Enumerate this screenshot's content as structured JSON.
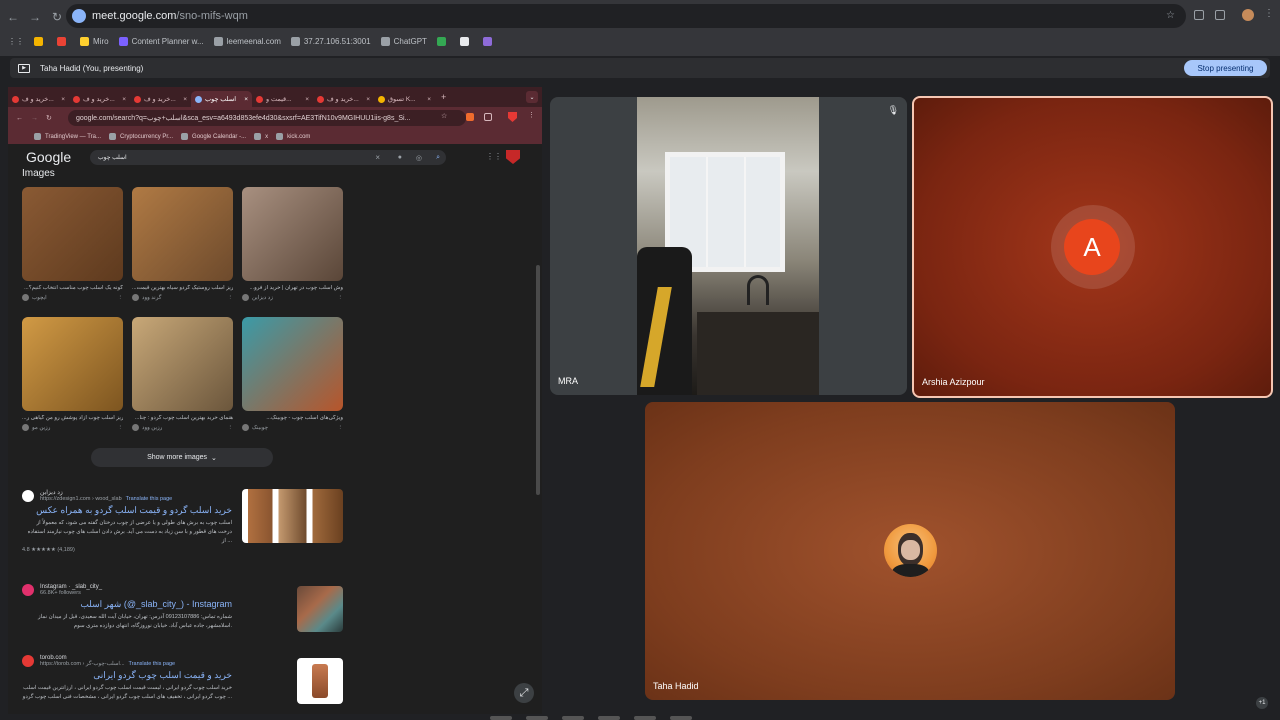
{
  "browser": {
    "url_host": "meet.google.com",
    "url_path": "/sno-mifs-wqm",
    "bookmarks": [
      {
        "label": "",
        "color": "#f4b400"
      },
      {
        "label": "",
        "color": "#ea4335"
      },
      {
        "label": "Miro",
        "color": "#ffd02f"
      },
      {
        "label": "Content Planner w...",
        "color": "#7b61ff"
      },
      {
        "label": "leemeenal.com",
        "color": "#9aa0a6"
      },
      {
        "label": "37.27.106.51:3001",
        "color": "#9aa0a6"
      },
      {
        "label": "ChatGPT",
        "color": "#9aa0a6"
      },
      {
        "label": "",
        "color": "#34a853"
      },
      {
        "label": "",
        "color": "#e8eaed"
      },
      {
        "label": "",
        "color": "#8e6bd8"
      }
    ]
  },
  "presenting": {
    "label": "Taha Hadid (You, presenting)",
    "stop_button": "Stop presenting"
  },
  "shared_screen": {
    "tabs": [
      {
        "label": "خرید و ف..."
      },
      {
        "label": "خرید و ف..."
      },
      {
        "label": "خرید و ف..."
      },
      {
        "label": "اسلب چوب",
        "active": true
      },
      {
        "label": "قیمت و..."
      },
      {
        "label": "خرید و ف..."
      },
      {
        "label": "تسوق K..."
      }
    ],
    "url": "google.com/search?q=اسلب+چوب&sca_esv=a6493d853efe4d30&sxsrf=AE3TifN10v9MGIHUU1iis-g8s_Si...",
    "bookmarks": [
      "TradingView — Tra...",
      "Cryptocurrency Pr...",
      "Google Calendar -...",
      "x",
      "kick.com"
    ],
    "google_logo": "Google",
    "search_query": "اسلب چوب",
    "images_heading": "Images",
    "images": [
      {
        "caption": "...گونه یک اسلب چوب مناسب انتخاب کنیم؟",
        "source": "ایچوب",
        "colors": [
          "#8a5a34",
          "#5e3a1e"
        ]
      },
      {
        "caption": "...ریز اسلب روستیک گردو سیاه بهترین قیمت",
        "source": "گرند وود",
        "colors": [
          "#b07a44",
          "#6d4a2c"
        ]
      },
      {
        "caption": "...وش اسلب چوب در تهران | خرید از فرو",
        "source": "زد دیزاین",
        "colors": [
          "#a89080",
          "#5a4638"
        ]
      },
      {
        "caption": "...ریز اسلب چوب آزاد پوشش رو من گیاهی ر",
        "source": "رزین مو",
        "colors": [
          "#d19a45",
          "#7d5520"
        ]
      },
      {
        "caption": "...هنمای خرید بهترین اسلب چوب گردو : چنا",
        "source": "رزین وود",
        "colors": [
          "#c8a878",
          "#6b563c"
        ]
      },
      {
        "caption": "...ویژگی‌های اسلب چوب - چوبینک",
        "source": "چوبینک",
        "colors": [
          "#3a9ba8",
          "#b8552a"
        ]
      }
    ],
    "show_more": "Show more images",
    "results": [
      {
        "site_name": "زد دیزاین",
        "url": "https://zdesign1.com › wood_slab",
        "translate": "Translate this page",
        "title": "خرید اسلب گردو و قیمت اسلب گردو به همراه عکس",
        "snippet": "اسلب چوب به برش های طولی و یا عرضی از چوب درختان گفته می شود، که معمولاً از درخت های قطور و با سن زیاد به دست می آید. برش دادن اسلب های چوب نیازمند استفاده از ...",
        "rating": "4.8 ★★★★★ (4,189)"
      },
      {
        "site_name": "Instagram · _slab_city_",
        "url": "66.8K+ followers",
        "translate": "",
        "title": "شهر اسلب (@_slab_city_) - Instagram",
        "snippet": "شماره تماس: 09123107886 آدرس: تهران، خیابان آیت الله سعیدی، قبل از میدان نماز اسلامشهر، جاده عباس آباد. خیابان نوروزگاه، انتهای دوازده متری سوم.",
        "rating": ""
      },
      {
        "site_name": "torob.com",
        "url": "https://torob.com › اسلب-چوب-گر...",
        "translate": "Translate this page",
        "title": "خرید و قیمت اسلب چوب گردو ایرانی",
        "snippet": "خرید اسلب چوب گردو ایرانی ، لیست قیمت اسلب چوب گردو ایرانی ، ارزانترین قیمت اسلب چوب گردو ایرانی ، تخفیف های اسلب چوب گردو ایرانی ، مشخصات فنی اسلب چوب گردو ...",
        "rating": ""
      }
    ]
  },
  "participants": {
    "mra": {
      "name": "MRA"
    },
    "arshia": {
      "name": "Arshia Azizpour",
      "initial": "A"
    },
    "taha": {
      "name": "Taha Hadid"
    }
  },
  "overflow_badge": "+1"
}
